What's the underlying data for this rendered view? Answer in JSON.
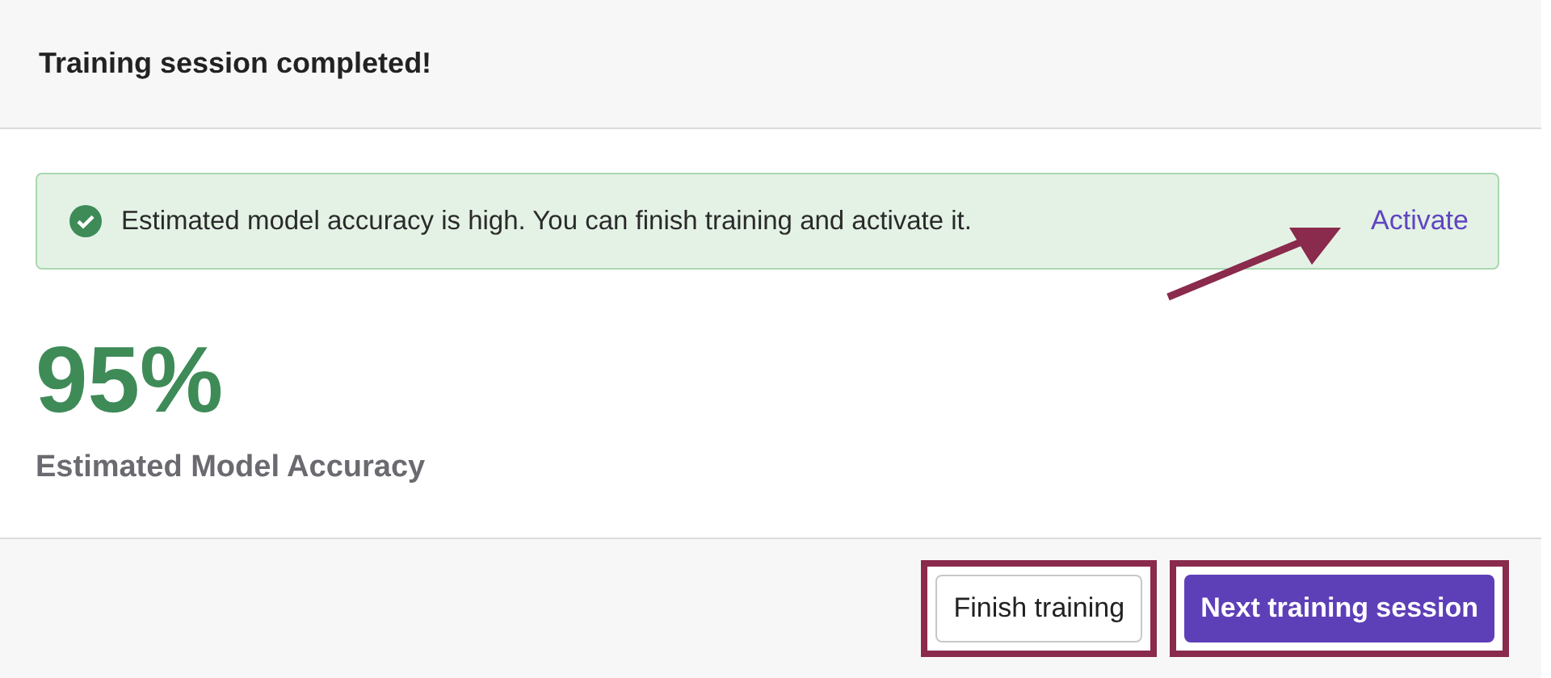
{
  "header": {
    "title": "Training session completed!"
  },
  "alert": {
    "message": "Estimated model accuracy is high. You can finish training and activate it.",
    "action": "Activate"
  },
  "metric": {
    "value": "95%",
    "label": "Estimated Model Accuracy"
  },
  "buttons": [
    {
      "label": "Finish training",
      "kind": "secondary"
    },
    {
      "label": "Next training session",
      "kind": "primary"
    }
  ]
}
